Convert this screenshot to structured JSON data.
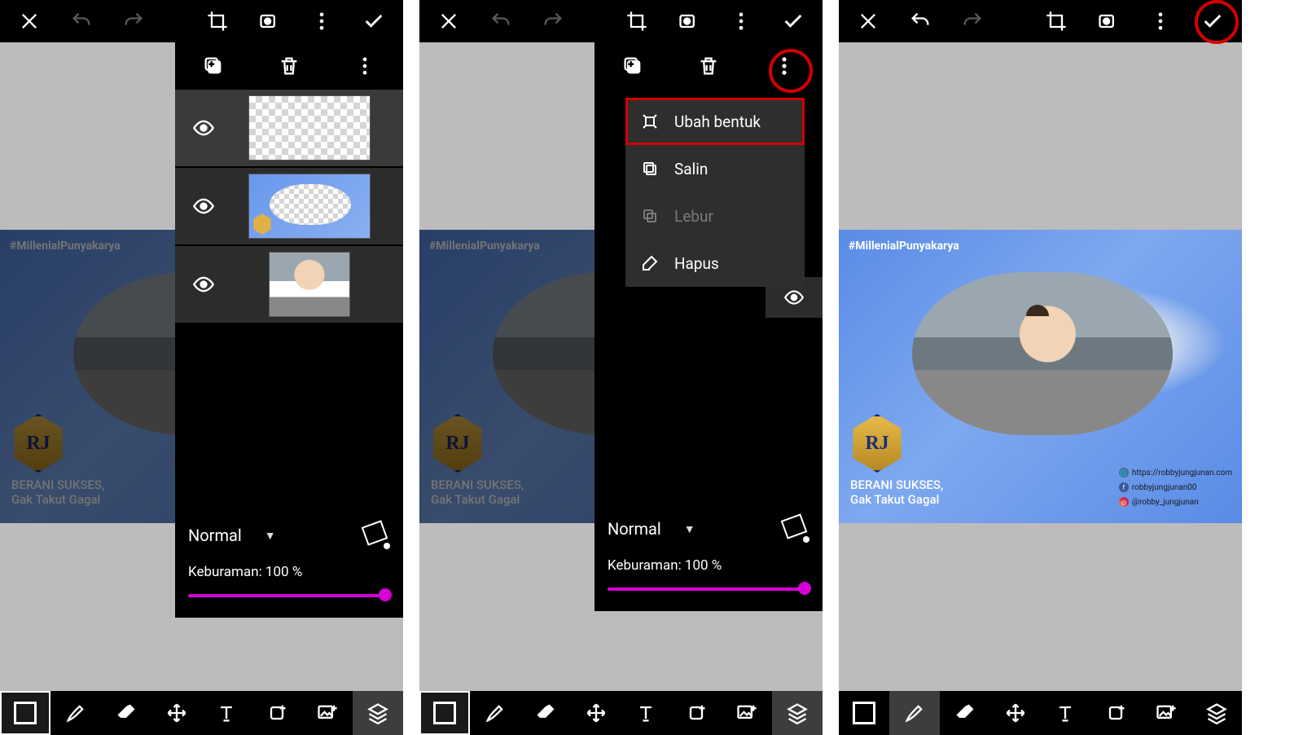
{
  "artwork": {
    "hashtag": "#MillenialPunyakarya",
    "logo_text": "RJ",
    "tagline1": "BERANI SUKSES,",
    "tagline2": "Gak Takut Gagal",
    "social_web": "https://robbyjungjunan.com",
    "social_fb": "robbyjungjunan00",
    "social_ig": "@robby_jungjunan"
  },
  "panel": {
    "blend_mode": "Normal",
    "opacity_label": "Keburaman: 100 %"
  },
  "context_menu": {
    "transform": "Ubah bentuk",
    "copy": "Salin",
    "merge": "Lebur",
    "delete": "Hapus"
  }
}
